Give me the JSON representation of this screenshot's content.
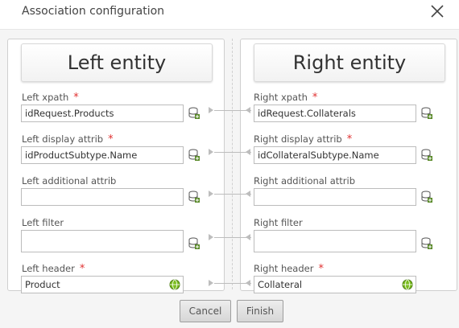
{
  "dialog": {
    "title": "Association configuration"
  },
  "left": {
    "title": "Left entity",
    "xpath_label": "Left xpath",
    "xpath_value": "idRequest.Products",
    "display_label": "Left display attrib",
    "display_value": "idProductSubtype.Name",
    "additional_label": "Left additional attrib",
    "additional_value": "",
    "filter_label": "Left filter",
    "filter_value": "",
    "header_label": "Left header",
    "header_value": "Product"
  },
  "right": {
    "title": "Right entity",
    "xpath_label": "Right xpath",
    "xpath_value": "idRequest.Collaterals",
    "display_label": "Right display attrib",
    "display_value": "idCollateralSubtype.Name",
    "additional_label": "Right additional attrib",
    "additional_value": "",
    "filter_label": "Right filter",
    "filter_value": "",
    "header_label": "Right header",
    "header_value": "Collateral"
  },
  "required_mark": "*",
  "buttons": {
    "cancel": "Cancel",
    "finish": "Finish"
  },
  "colors": {
    "required": "#e03030",
    "db_icon": "#5a8a2a",
    "globe_icon": "#7bbd1f"
  }
}
